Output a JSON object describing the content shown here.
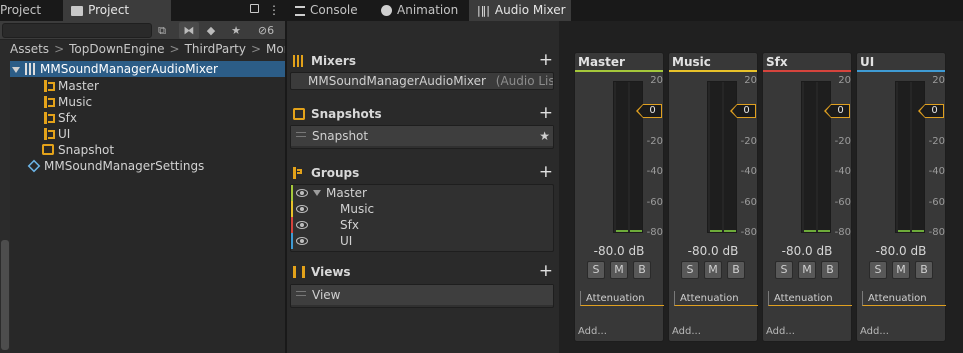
{
  "left": {
    "tabs": [
      {
        "label": "Project"
      },
      {
        "label": "Project"
      }
    ],
    "toolbar": {
      "search_value": "",
      "hidden_count": "6"
    },
    "breadcrumb": [
      "Assets",
      "TopDownEngine",
      "ThirdParty",
      "More"
    ],
    "tree": {
      "mixer": "MMSoundManagerAudioMixer",
      "groups": [
        "Master",
        "Music",
        "Sfx",
        "UI"
      ],
      "snapshot": "Snapshot",
      "settings": "MMSoundManagerSettings"
    }
  },
  "right": {
    "tabs": [
      {
        "label": "Console"
      },
      {
        "label": "Animation"
      },
      {
        "label": "Audio Mixer"
      }
    ],
    "sections": {
      "mixers": {
        "title": "Mixers",
        "item": "MMSoundManagerAudioMixer",
        "suffix": "(Audio Liste"
      },
      "snapshots": {
        "title": "Snapshots",
        "item": "Snapshot"
      },
      "groups": {
        "title": "Groups",
        "items": [
          "Master",
          "Music",
          "Sfx",
          "UI"
        ]
      },
      "views": {
        "title": "Views",
        "item": "View"
      }
    },
    "strips": [
      {
        "name": "Master",
        "color": "#a5c83b",
        "db": "-80.0 dB",
        "fader_value": "0",
        "effect": "Attenuation",
        "add": "Add..."
      },
      {
        "name": "Music",
        "color": "#e8c22a",
        "db": "-80.0 dB",
        "fader_value": "0",
        "effect": "Attenuation",
        "add": "Add..."
      },
      {
        "name": "Sfx",
        "color": "#d6443d",
        "db": "-80.0 dB",
        "fader_value": "0",
        "effect": "Attenuation",
        "add": "Add..."
      },
      {
        "name": "UI",
        "color": "#3f9bd4",
        "db": "-80.0 dB",
        "fader_value": "0",
        "effect": "Attenuation",
        "add": "Add..."
      }
    ],
    "scale_labels": [
      "20",
      "0",
      "-20",
      "-40",
      "-60",
      "-80"
    ],
    "button_labels": {
      "solo": "S",
      "mute": "M",
      "bypass": "B"
    }
  },
  "colors": {
    "selection": "#2c5d87",
    "accent": "#e0a020",
    "meter_level": "#6dab3a"
  }
}
